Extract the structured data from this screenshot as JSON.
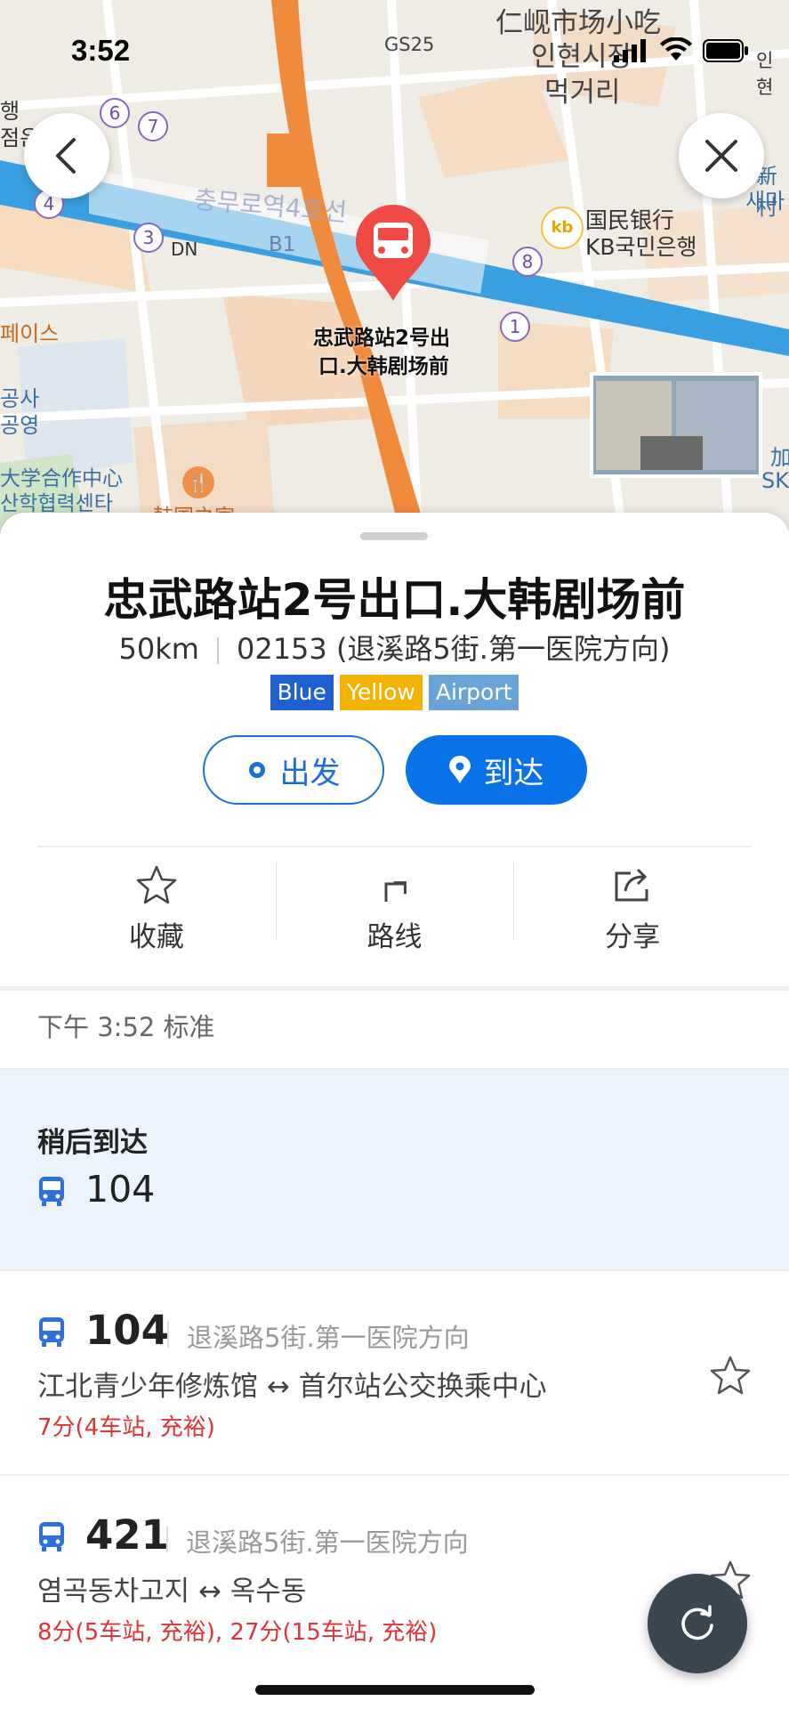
{
  "status_bar": {
    "time": "3:52"
  },
  "map": {
    "labels": {
      "gs25": "GS25",
      "market_cn": "仁岘市场小吃",
      "market_kr1": "인현시장",
      "market_kr2": "먹거리",
      "bank_cn": "国民银行",
      "bank_kr": "KB국민은행",
      "station_faded": "충무로역4호선",
      "b1": "B1",
      "dn": "DN",
      "marker_label_line1": "忠武路站2号出",
      "marker_label_line2": "口.大韩剧场前",
      "left_edge_1": "행",
      "left_edge_2": "점은",
      "left_edge_3": "페이스",
      "left_edge_4": "공사",
      "left_edge_5": "공영",
      "left_edge_6": "大学合作中心",
      "left_edge_7": "산학협력센타",
      "restaurant": "韩国之家",
      "right_edge_1": "인현",
      "right_edge_2": "新村",
      "right_edge_3": "새마",
      "right_edge_4": "加",
      "right_edge_5": "SK",
      "exit_numbers": [
        "6",
        "7",
        "4",
        "3",
        "8",
        "1"
      ]
    }
  },
  "stop": {
    "title": "忠武路站2号出口.大韩剧场前",
    "distance": "50km",
    "stop_id": "02153 (退溪路5街.第一医院方向)",
    "tags": [
      {
        "label": "Blue",
        "color": "#1f5fd0"
      },
      {
        "label": "Yellow",
        "color": "#f2b300"
      },
      {
        "label": "Airport",
        "color": "#6aa4d6"
      }
    ]
  },
  "buttons": {
    "depart": "出发",
    "arrive": "到达"
  },
  "actions": {
    "favorite": "收藏",
    "route": "路线",
    "share": "分享"
  },
  "time_info": "下午 3:52 标准",
  "arrival": {
    "label": "稍后到达",
    "bus": "104"
  },
  "routes": [
    {
      "number": "104",
      "direction": "退溪路5街.第一医院方向",
      "path": "江北青少年修炼馆 ↔ 首尔站公交换乘中心",
      "eta": "7分(4车站, 充裕)"
    },
    {
      "number": "421",
      "direction": "退溪路5街.第一医院方向",
      "path": "염곡동차고지 ↔ 옥수동",
      "eta": "8分(5车站, 充裕), 27分(15车站, 充裕)"
    }
  ],
  "colors": {
    "accent": "#0a72e8",
    "bus_icon": "#2f6fdb",
    "eta_red": "#e03333",
    "marker_red": "#ef4a46"
  }
}
